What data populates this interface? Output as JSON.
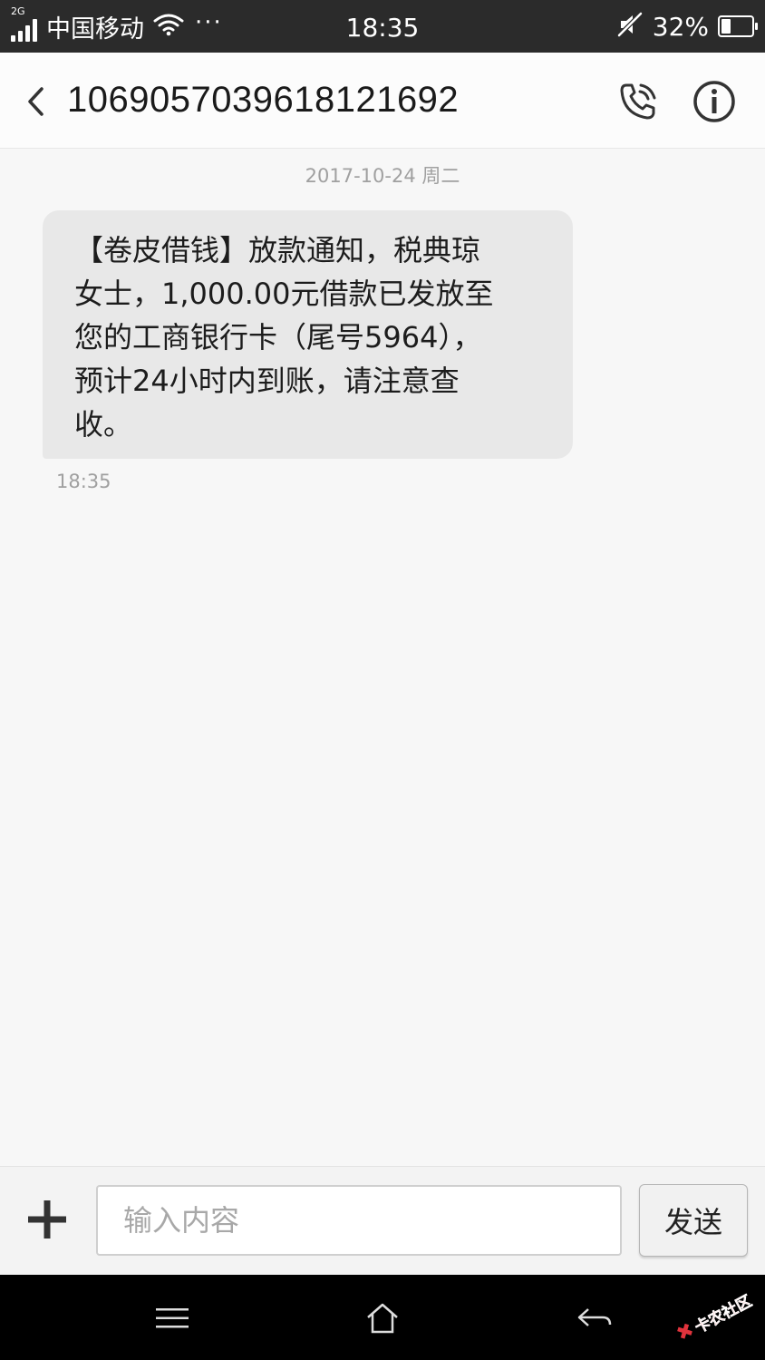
{
  "status_bar": {
    "network_type": "2G",
    "carrier": "中国移动",
    "more": "···",
    "time": "18:35",
    "battery_percent": "32%",
    "battery_level": 0.32
  },
  "header": {
    "title": "1069057039618121692",
    "back_icon": "chevron-left-icon",
    "call_icon": "phone-icon",
    "info_icon": "info-icon"
  },
  "conversation": {
    "date_separator": "2017-10-24 周二",
    "messages": [
      {
        "lines": [
          "【卷皮借钱】放款通知，税典琼",
          "女士，1,000.00元借款已发放至",
          "您的工商银行卡（尾号5964），",
          "预计24小时内到账，请注意查",
          "收。"
        ],
        "time": "18:35"
      }
    ]
  },
  "composer": {
    "add_icon": "plus-icon",
    "input_placeholder": "输入内容",
    "input_value": "",
    "send_label": "发送"
  },
  "nav_bar": {
    "menu_icon": "menu-icon",
    "home_icon": "home-icon",
    "back_icon": "back-arrow-icon"
  },
  "watermark": {
    "text": "卡农社区"
  },
  "colors": {
    "status_bg": "#2b2b2b",
    "bubble_bg": "#e8e8e8",
    "page_bg": "#f7f7f7",
    "watermark": "#e0333c"
  }
}
